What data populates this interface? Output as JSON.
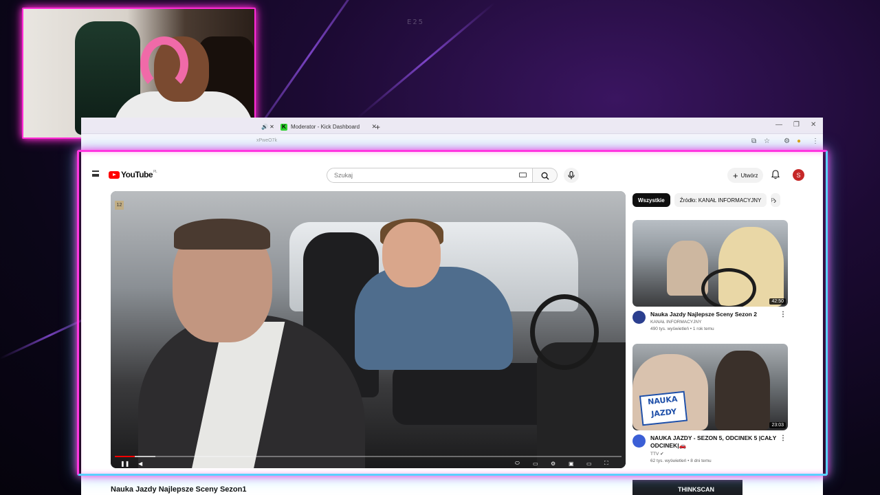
{
  "overlay": {
    "label": "E25"
  },
  "browser": {
    "tabs": [
      {
        "label": "Moderator - Kick Dashboard"
      }
    ],
    "url_fragment": "xPweO7k"
  },
  "youtube": {
    "logo": "YouTube",
    "region": "PL",
    "search_placeholder": "Szukaj",
    "create_label": "Utwórz",
    "avatar_letter": "S",
    "video": {
      "title": "Nauka Jazdy Najlepsze Sceny Sezon1",
      "badge": "12",
      "progress": 0.04,
      "buffered": 0.08
    },
    "chips": [
      {
        "label": "Wszystkie",
        "active": true
      },
      {
        "label": "Źródło: KANAŁ INFORMACYJNY",
        "active": false
      }
    ],
    "recommendations": [
      {
        "title": "Nauka Jazdy Najlepsze Sceny Sezon 2",
        "channel": "KANAŁ INFORMACYJNY",
        "stats": "490 tys. wyświetleń • 1 rok temu",
        "duration": "42:50",
        "avatar_color": "#2b3f8f"
      },
      {
        "title": "NAUKA JAZDY - SEZON 5, ODCINEK 5 |CAŁY ODCINEK|🚗",
        "channel": "TTV",
        "stats": "62 tys. wyświetleń • 8 dni temu",
        "duration": "23:03",
        "avatar_color": "#3b5fd6",
        "logo_text": "NAUKA JAZDY"
      }
    ],
    "next_thumb_text": "THINKSCAN"
  },
  "colors": {
    "neon_pink": "#ff36e0",
    "neon_blue": "#5ad1ff",
    "yt_red": "#ff0000"
  }
}
